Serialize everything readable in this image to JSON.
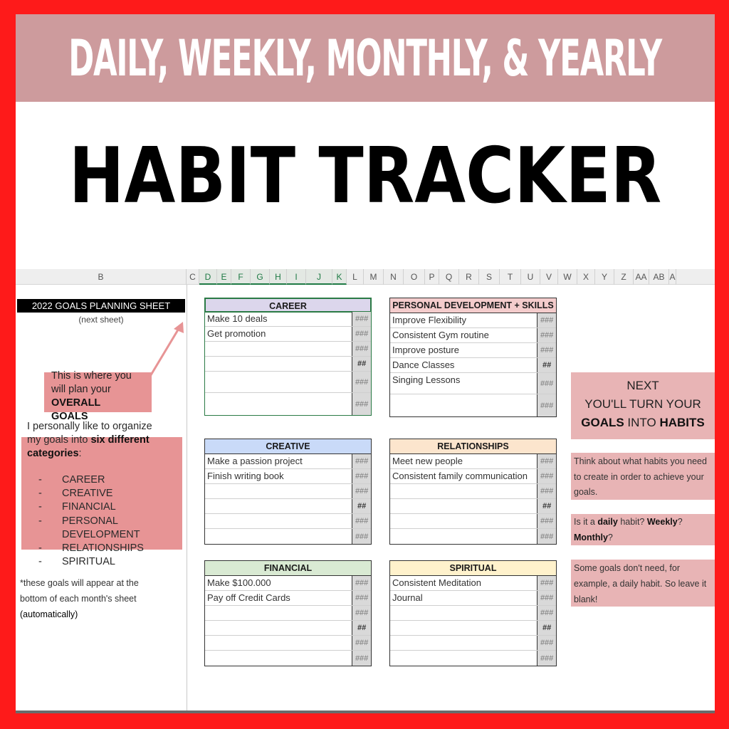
{
  "banner": {
    "title": "DAILY, WEEKLY, MONTHLY, & YEARLY"
  },
  "headline": {
    "title": "HABIT TRACKER"
  },
  "spreadsheet": {
    "columns": [
      "B",
      "C",
      "D",
      "E",
      "F",
      "G",
      "H",
      "I",
      "J",
      "K",
      "L",
      "M",
      "N",
      "O",
      "P",
      "Q",
      "R",
      "S",
      "T",
      "U",
      "V",
      "W",
      "X",
      "Y",
      "Z",
      "AA",
      "AB",
      "A"
    ],
    "selected_columns": [
      "D",
      "E",
      "F",
      "G",
      "H",
      "I",
      "J",
      "K"
    ]
  },
  "left_panel": {
    "title": "2022 GOALS PLANNING SHEET",
    "subtitle": "(next sheet)",
    "callout_line1": "This is where you",
    "callout_line2": "will plan your",
    "callout_bold1": "OVERALL",
    "callout_bold2": "GOALS",
    "intro_line1": "I personally like to organize",
    "intro_line2_pre": "my goals into ",
    "intro_line2_bold": "six different",
    "intro_line3_bold": "categories",
    "intro_line3_post": ":",
    "categories": [
      {
        "dash": "-",
        "label": "CAREER"
      },
      {
        "dash": "-",
        "label": "CREATIVE"
      },
      {
        "dash": "-",
        "label": "FINANCIAL"
      },
      {
        "dash": "-",
        "label": "PERSONAL"
      },
      {
        "dash": "",
        "label": "DEVELOPMENT"
      },
      {
        "dash": "-",
        "label": "RELATIONSHIPS"
      },
      {
        "dash": "-",
        "label": "SPIRITUAL"
      }
    ],
    "footnote_line1": "*these goals will appear at the",
    "footnote_line2": "bottom of each month's sheet",
    "footnote_line3": "(automatically)"
  },
  "categories": [
    {
      "name": "CAREER",
      "color": "#dcd6ec",
      "goals": [
        "Make 10 deals",
        "Get promotion",
        "",
        "",
        "",
        ""
      ],
      "counts": [
        "###",
        "###",
        "###",
        "##",
        "###",
        "###"
      ]
    },
    {
      "name": "PERSONAL DEVELOPMENT + SKILLS",
      "color": "#f4cccc",
      "goals": [
        "Improve Flexibility",
        "Consistent Gym routine",
        "Improve posture",
        "Dance Classes",
        "Singing Lessons",
        ""
      ],
      "counts": [
        "###",
        "###",
        "###",
        "##",
        "###",
        "###"
      ]
    },
    {
      "name": "CREATIVE",
      "color": "#c9daf8",
      "goals": [
        "Make a passion project",
        "Finish writing book",
        "",
        "",
        "",
        ""
      ],
      "counts": [
        "###",
        "###",
        "###",
        "##",
        "###",
        "###"
      ]
    },
    {
      "name": "RELATIONSHIPS",
      "color": "#fce5cd",
      "goals": [
        "Meet new people",
        "Consistent family communication",
        "",
        "",
        "",
        ""
      ],
      "counts": [
        "###",
        "###",
        "###",
        "##",
        "###",
        "###"
      ]
    },
    {
      "name": "FINANCIAL",
      "color": "#d9ead3",
      "goals": [
        "Make $100.000",
        "Pay off Credit Cards",
        "",
        "",
        "",
        ""
      ],
      "counts": [
        "###",
        "###",
        "###",
        "##",
        "###",
        "###"
      ]
    },
    {
      "name": "SPIRITUAL",
      "color": "#fff2cc",
      "goals": [
        "Consistent Meditation",
        "Journal",
        "",
        "",
        "",
        ""
      ],
      "counts": [
        "###",
        "###",
        "###",
        "##",
        "###",
        "###"
      ]
    }
  ],
  "right_panel": {
    "next_line1": "NEXT",
    "next_line2": "YOU'LL TURN YOUR",
    "next_goals": "GOALS",
    "next_into": " INTO ",
    "next_habits": "HABITS",
    "think_line1": "Think about what habits you need",
    "think_line2": "to create in order to achieve your",
    "think_line3": "goals.",
    "q_pre": "Is it a ",
    "q_daily": "daily",
    "q_mid": " habit? ",
    "q_weekly": "Weekly",
    "q_q1": "?",
    "q_monthly": "Monthly",
    "q_q2": "?",
    "some_line1": "Some goals don't need, for",
    "some_line2": "example, a daily habit. So leave it",
    "some_line3": "blank!"
  },
  "colors": {
    "frame": "#fe1a1a",
    "banner": "#cd9b9d",
    "callout": "#e79495",
    "right_callout": "#e8b4b5",
    "selection": "#1f7a45"
  }
}
